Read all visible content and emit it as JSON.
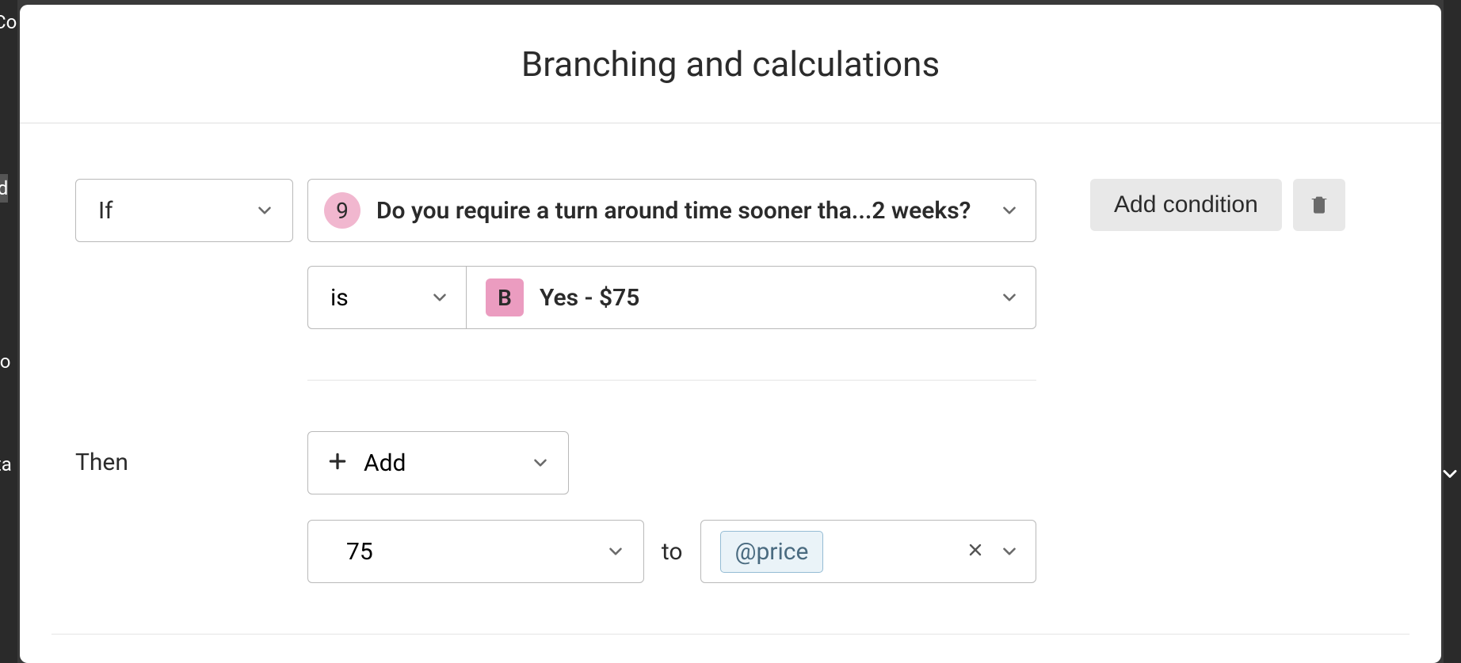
{
  "background_fragments": [
    "Co",
    "ed",
    "tio",
    "ita"
  ],
  "modal": {
    "title": "Branching and calculations"
  },
  "condition": {
    "if_label": "If",
    "question_number": "9",
    "question_text": "Do you require a turn around time sooner tha...2 weeks?",
    "operator": "is",
    "answer_letter": "B",
    "answer_text": "Yes - $75",
    "add_condition_label": "Add condition"
  },
  "action": {
    "then_label": "Then",
    "action_label": "Add",
    "value": "75",
    "to_label": "to",
    "target_variable": "@price"
  }
}
